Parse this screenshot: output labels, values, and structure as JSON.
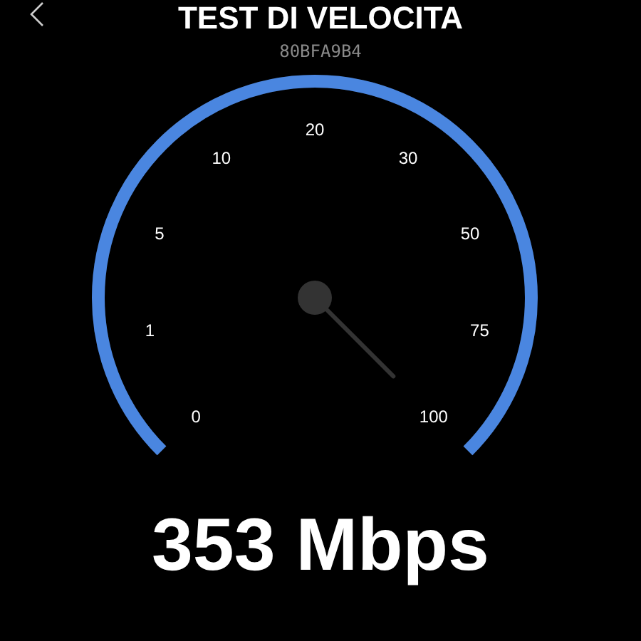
{
  "header": {
    "title": "TEST DI VELOCITA",
    "device_id": "80BFA9B4"
  },
  "gauge": {
    "level": 1,
    "scale": [
      "0",
      "1",
      "5",
      "10",
      "20",
      "30",
      "50",
      "75",
      "100"
    ]
  },
  "result": {
    "speed": "353 Mbps"
  }
}
